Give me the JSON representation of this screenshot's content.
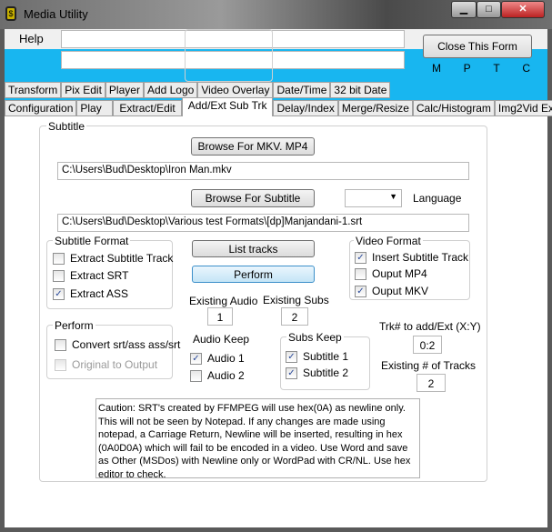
{
  "window": {
    "title": "Media Utility",
    "icon": "app-icon",
    "controls": [
      "minimize",
      "maximize",
      "close"
    ]
  },
  "menu": {
    "help": "Help"
  },
  "top": {
    "input1": "",
    "input2": "",
    "close_button": "Close This Form",
    "indicators": [
      "M",
      "P",
      "T",
      "C"
    ]
  },
  "tabs_row1": [
    "Transform",
    "Pix Edit",
    "Player",
    "Add Logo",
    "Video Overlay",
    "Date/Time",
    "32 bit Date"
  ],
  "tabs_row2": [
    "Configuration",
    "Play",
    "Extract/Edit",
    "Add/Ext Sub Trk",
    "Delay/Index",
    "Merge/Resize",
    "Calc/Histogram",
    "Img2Vid Extrct"
  ],
  "active_tab": "Add/Ext Sub Trk",
  "subtitle": {
    "group_label": "Subtitle",
    "browse_mkv": "Browse For MKV. MP4",
    "mkv_path": "C:\\Users\\Bud\\Desktop\\Iron Man.mkv",
    "browse_sub": "Browse For Subtitle",
    "language_value": "",
    "language_label": "Language",
    "sub_path": "C:\\Users\\Bud\\Desktop\\Various test Formats\\[dp]Manjandani-1.srt",
    "list_tracks": "List tracks",
    "perform": "Perform",
    "subtitle_format": {
      "label": "Subtitle Format",
      "items": [
        {
          "label": "Extract Subtitle Track",
          "checked": false
        },
        {
          "label": "Extract SRT",
          "checked": false
        },
        {
          "label": "Extract ASS",
          "checked": true
        }
      ]
    },
    "video_format": {
      "label": "Video Format",
      "items": [
        {
          "label": "Insert Subtitle Track",
          "checked": true
        },
        {
          "label": "Ouput MP4",
          "checked": false
        },
        {
          "label": "Ouput MKV",
          "checked": true
        }
      ]
    },
    "perform_group": {
      "label": "Perform",
      "items": [
        {
          "label": "Convert srt/ass ass/srt",
          "checked": false
        },
        {
          "label": "Original to Output",
          "checked": false,
          "disabled": true
        }
      ]
    },
    "existing_audio": {
      "label": "Existing Audio",
      "value": "1"
    },
    "existing_subs": {
      "label": "Existing Subs",
      "value": "2"
    },
    "audio_keep": {
      "label": "Audio Keep",
      "items": [
        {
          "label": "Audio 1",
          "checked": true
        },
        {
          "label": "Audio 2",
          "checked": false
        }
      ]
    },
    "subs_keep": {
      "label": "Subs Keep",
      "items": [
        {
          "label": "Subtitle 1",
          "checked": true
        },
        {
          "label": "Subtitle 2",
          "checked": true
        }
      ]
    },
    "trk_add": {
      "label": "Trk# to add/Ext (X:Y)",
      "value": "0:2"
    },
    "existing_tracks": {
      "label": "Existing # of Tracks",
      "value": "2"
    },
    "caution": "Caution: SRT's created by FFMPEG will use hex(0A) as newline only.  This will not be seen by Notepad.  If any changes are made using notepad, a Carriage Return, Newline will be inserted, resulting in hex (0A0D0A) which will fail to be encoded in a video. Use Word and save as Other (MSDos) with Newline only or WordPad with CR/NL. Use hex editor to check."
  }
}
